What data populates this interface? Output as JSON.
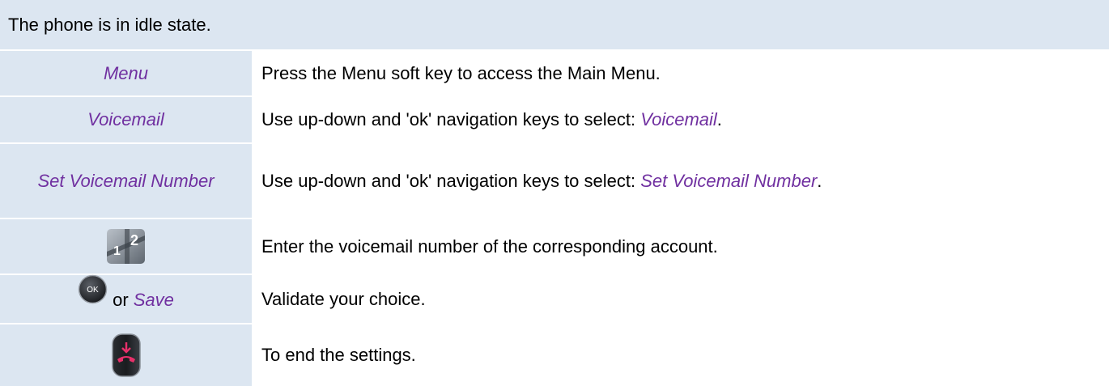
{
  "header": {
    "text": "The phone is in idle state."
  },
  "rows": [
    {
      "key_label": "Menu",
      "description": "Press the Menu soft key to access the Main Menu."
    },
    {
      "key_label": "Voicemail",
      "description_prefix": "Use up-down and 'ok' navigation keys to select: ",
      "description_highlight": "Voicemail",
      "description_suffix": "."
    },
    {
      "key_label": "Set Voicemail Number",
      "description_prefix": "Use up-down and 'ok' navigation keys to select: ",
      "description_highlight": "Set Voicemail Number",
      "description_suffix": "."
    },
    {
      "key_icon": "keypad-icon",
      "description": "Enter the voicemail number of the corresponding account."
    },
    {
      "key_icon": "ok-key-icon",
      "key_or": "or",
      "key_label": "Save",
      "description": "Validate your choice."
    },
    {
      "key_icon": "end-call-key-icon",
      "description": "To end the settings."
    }
  ],
  "colors": {
    "header_bg": "#dce6f1",
    "highlight": "#7030a0"
  }
}
